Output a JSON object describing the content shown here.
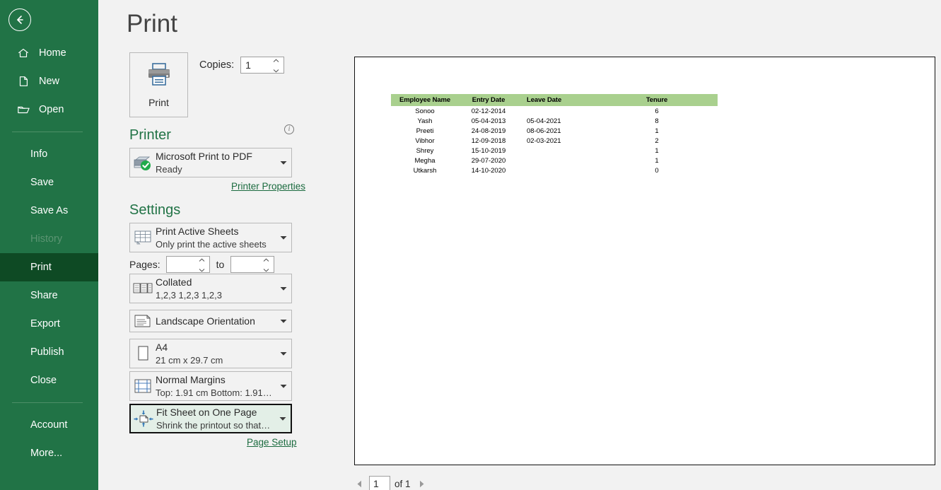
{
  "window": {
    "title": "Print",
    "back_icon": "back-arrow-icon"
  },
  "sidebar": {
    "items": [
      {
        "label": "Home",
        "icon": "home-icon",
        "state": "normal",
        "has_icon": true
      },
      {
        "label": "New",
        "icon": "page-icon",
        "state": "normal",
        "has_icon": true
      },
      {
        "label": "Open",
        "icon": "folder-icon",
        "state": "normal",
        "has_icon": true
      },
      {
        "label": "Info",
        "icon": "",
        "state": "normal",
        "has_icon": false
      },
      {
        "label": "Save",
        "icon": "",
        "state": "normal",
        "has_icon": false
      },
      {
        "label": "Save As",
        "icon": "",
        "state": "normal",
        "has_icon": false
      },
      {
        "label": "History",
        "icon": "",
        "state": "disabled",
        "has_icon": false
      },
      {
        "label": "Print",
        "icon": "",
        "state": "selected",
        "has_icon": false
      },
      {
        "label": "Share",
        "icon": "",
        "state": "normal",
        "has_icon": false
      },
      {
        "label": "Export",
        "icon": "",
        "state": "normal",
        "has_icon": false
      },
      {
        "label": "Publish",
        "icon": "",
        "state": "normal",
        "has_icon": false
      },
      {
        "label": "Close",
        "icon": "",
        "state": "normal",
        "has_icon": false
      },
      {
        "label": "Account",
        "icon": "",
        "state": "normal",
        "has_icon": false
      },
      {
        "label": "More...",
        "icon": "",
        "state": "normal",
        "has_icon": false
      }
    ]
  },
  "print_panel": {
    "print_button_label": "Print",
    "print_button_icon": "printer-icon",
    "copies_label": "Copies:",
    "copies_value": "1",
    "printer_section_title": "Printer",
    "printer_info_icon": "info-icon",
    "printer_name": "Microsoft Print to PDF",
    "printer_status": "Ready",
    "printer_icon": "printer-ready-icon",
    "printer_properties_link": "Printer Properties",
    "settings_section_title": "Settings",
    "settings": [
      {
        "icon": "print-active-sheets-icon",
        "line1": "Print Active Sheets",
        "line2": "Only print the active sheets",
        "focused": false
      },
      {
        "icon": "collated-icon",
        "line1": "Collated",
        "line2": "1,2,3    1,2,3    1,2,3",
        "focused": false
      },
      {
        "icon": "landscape-orientation-icon",
        "line1": "Landscape Orientation",
        "line2": "",
        "focused": false
      },
      {
        "icon": "paper-size-icon",
        "line1": "A4",
        "line2": "21 cm x 29.7 cm",
        "focused": false
      },
      {
        "icon": "margins-icon",
        "line1": "Normal Margins",
        "line2": "Top: 1.91 cm Bottom: 1.91 c...",
        "focused": false
      },
      {
        "icon": "fit-sheet-one-page-icon",
        "line1": "Fit Sheet on One Page",
        "line2": "Shrink the printout so that it...",
        "focused": true
      }
    ],
    "pages_label": "Pages:",
    "pages_from_value": "",
    "pages_to_label": "to",
    "pages_to_value": "",
    "page_setup_link": "Page Setup"
  },
  "preview": {
    "table": {
      "headers": [
        "Employee Name",
        "Entry Date",
        "Leave Date",
        "Tenure"
      ],
      "rows": [
        [
          "Sonoo",
          "02-12-2014",
          "",
          "6"
        ],
        [
          "Yash",
          "05-04-2013",
          "05-04-2021",
          "8"
        ],
        [
          "Preeti",
          "24-08-2019",
          "08-06-2021",
          "1"
        ],
        [
          "Vibhor",
          "12-09-2018",
          "02-03-2021",
          "2"
        ],
        [
          "Shrey",
          "15-10-2019",
          "",
          "1"
        ],
        [
          "Megha",
          "29-07-2020",
          "",
          "1"
        ],
        [
          "Utkarsh",
          "14-10-2020",
          "",
          "0"
        ]
      ],
      "header_fill": "#A9D08E"
    },
    "pager": {
      "prev_icon": "chevron-left-icon",
      "next_icon": "chevron-right-icon",
      "current_page": "1",
      "of_text": "of 1"
    }
  },
  "colors": {
    "sidebar_green": "#217346",
    "sidebar_selected": "#0E4A24",
    "heading_green": "#217346",
    "link_green": "#1B6B3F",
    "canvas_gray": "#F2F2F2"
  }
}
